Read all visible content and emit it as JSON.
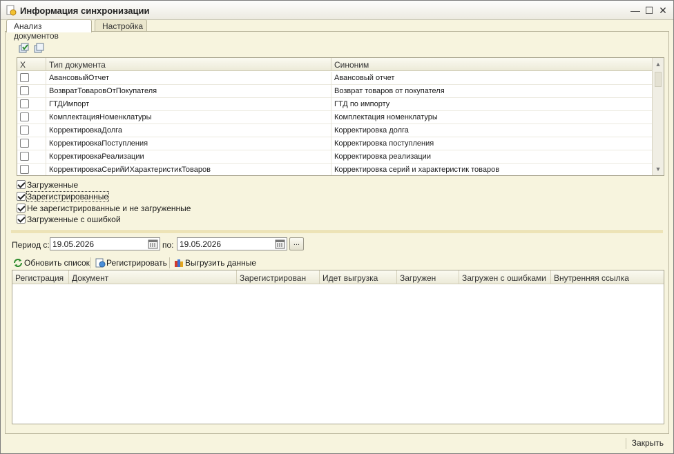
{
  "window": {
    "title": "Информация синхронизации",
    "minimize_icon": "minimize-icon",
    "maximize_icon": "maximize-icon",
    "close_icon": "close-icon"
  },
  "tabs": [
    {
      "label": "Анализ документов",
      "active": true
    },
    {
      "label": "Настройка",
      "active": false
    }
  ],
  "doc_grid": {
    "columns": [
      "X",
      "Тип документа",
      "Синоним"
    ],
    "rows": [
      {
        "checked": false,
        "type": "АвансовыйОтчет",
        "synonym": "Авансовый отчет"
      },
      {
        "checked": false,
        "type": "ВозвратТоваровОтПокупателя",
        "synonym": "Возврат товаров от покупателя"
      },
      {
        "checked": false,
        "type": "ГТДИмпорт",
        "synonym": "ГТД по импорту"
      },
      {
        "checked": false,
        "type": "КомплектацияНоменклатуры",
        "synonym": "Комплектация номенклатуры"
      },
      {
        "checked": false,
        "type": "КорректировкаДолга",
        "synonym": "Корректировка долга"
      },
      {
        "checked": false,
        "type": "КорректировкаПоступления",
        "synonym": "Корректировка поступления"
      },
      {
        "checked": false,
        "type": "КорректировкаРеализации",
        "synonym": "Корректировка реализации"
      },
      {
        "checked": false,
        "type": "КорректировкаСерийИХарактеристикТоваров",
        "synonym": "Корректировка серий и характеристик товаров"
      }
    ]
  },
  "filters": [
    {
      "label": "Загруженные",
      "checked": true
    },
    {
      "label": "Зарегистрированные",
      "checked": true
    },
    {
      "label": "Не зарегистрированные и не загруженные",
      "checked": true
    },
    {
      "label": "Загруженные с ошибкой",
      "checked": true
    }
  ],
  "period": {
    "from_label": "Период с:",
    "from_value": "19.05.2026",
    "to_label": "по:",
    "to_value": "19.05.2026",
    "more_label": "..."
  },
  "toolbar": {
    "refresh_label": "Обновить список",
    "register_label": "Регистрировать",
    "export_label": "Выгрузить данные"
  },
  "result_grid": {
    "columns": [
      "Регистрация",
      "Документ",
      "Зарегистрирован",
      "Идет выгрузка",
      "Загружен",
      "Загружен с ошибками",
      "Внутренняя ссылка"
    ]
  },
  "footer": {
    "close_label": "Закрыть"
  }
}
